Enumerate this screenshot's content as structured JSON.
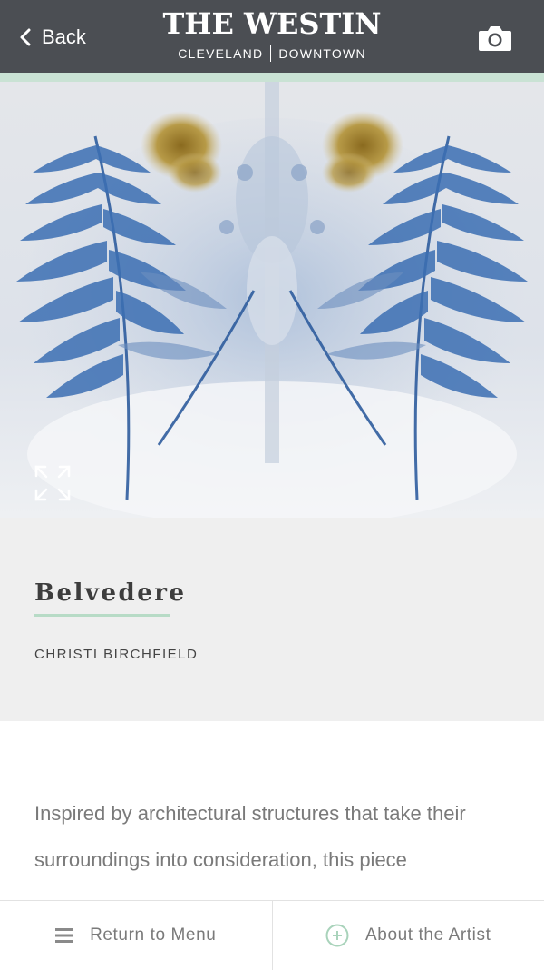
{
  "header": {
    "back_label": "Back",
    "brand_title": "THE WESTIN",
    "brand_left": "CLEVELAND",
    "brand_right": "DOWNTOWN",
    "camera_icon": "camera-icon",
    "background_color": "#4b4e53",
    "accent_color": "#c9e2d4"
  },
  "artwork": {
    "image_description_icon": "expand-icon"
  },
  "info": {
    "title": "Belvedere",
    "artist": "CHRISTI BIRCHFIELD",
    "underline_color": "#b7dbc6"
  },
  "body": {
    "description": "Inspired by architectural structures that take their surroundings into consideration, this piece"
  },
  "footer": {
    "menu_label": "Return to Menu",
    "menu_icon": "hamburger-icon",
    "artist_label": "About the Artist",
    "artist_icon": "plus-circle-icon"
  }
}
